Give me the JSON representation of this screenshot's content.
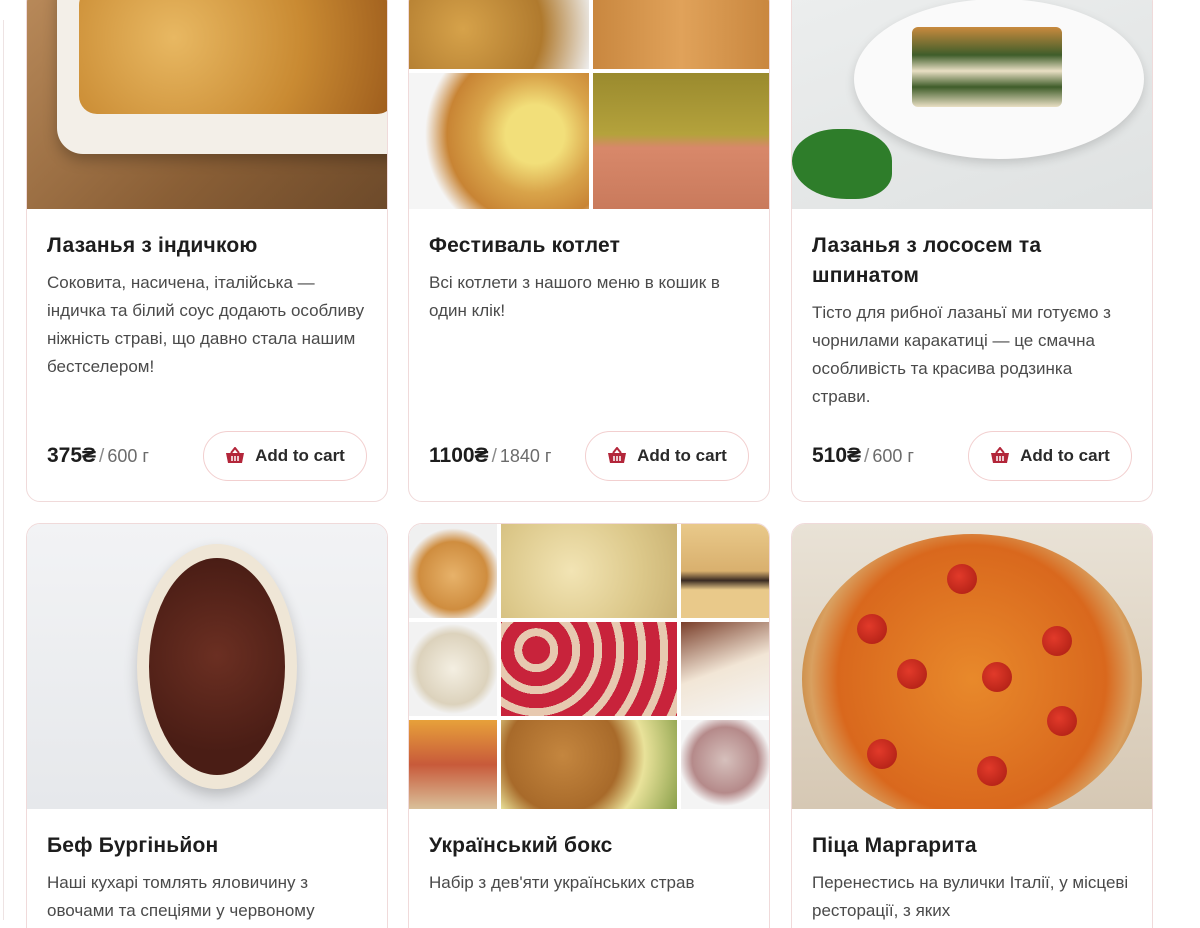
{
  "currency": "₴",
  "cart_button_label": "Add to cart",
  "products": [
    {
      "title": "Лазанья з індичкою",
      "description": "Соковита, насичена, італійська — індичка та білий соус додають особливу ніжність страві, що давно стала нашим бестселером!",
      "price": "375₴",
      "weight": "600 г"
    },
    {
      "title": "Фестиваль котлет",
      "description": "Всі котлети з нашого меню в кошик в один клік!",
      "price": "1100₴",
      "weight": "1840 г"
    },
    {
      "title": "Лазанья з лососем та шпинатом",
      "description": "Тісто для рибної лазаньї ми готуємо з чорнилами каракатиці — це смачна особливість та красива родзинка страви.",
      "price": "510₴",
      "weight": "600 г"
    },
    {
      "title": "Беф Бургіньйон",
      "description": "Наші кухарі томлять яловичину з овочами та спеціями у червоному"
    },
    {
      "title": "Український бокс",
      "description": "Набір з дев'яти українських страв"
    },
    {
      "title": "Піца Маргарита",
      "description": "Перенестись на вулички Італії, у місцеві ресторації, з яких"
    }
  ],
  "icons": {
    "cart": "basket-icon"
  },
  "colors": {
    "accent": "#b3263a",
    "card_border": "#f0dada"
  }
}
